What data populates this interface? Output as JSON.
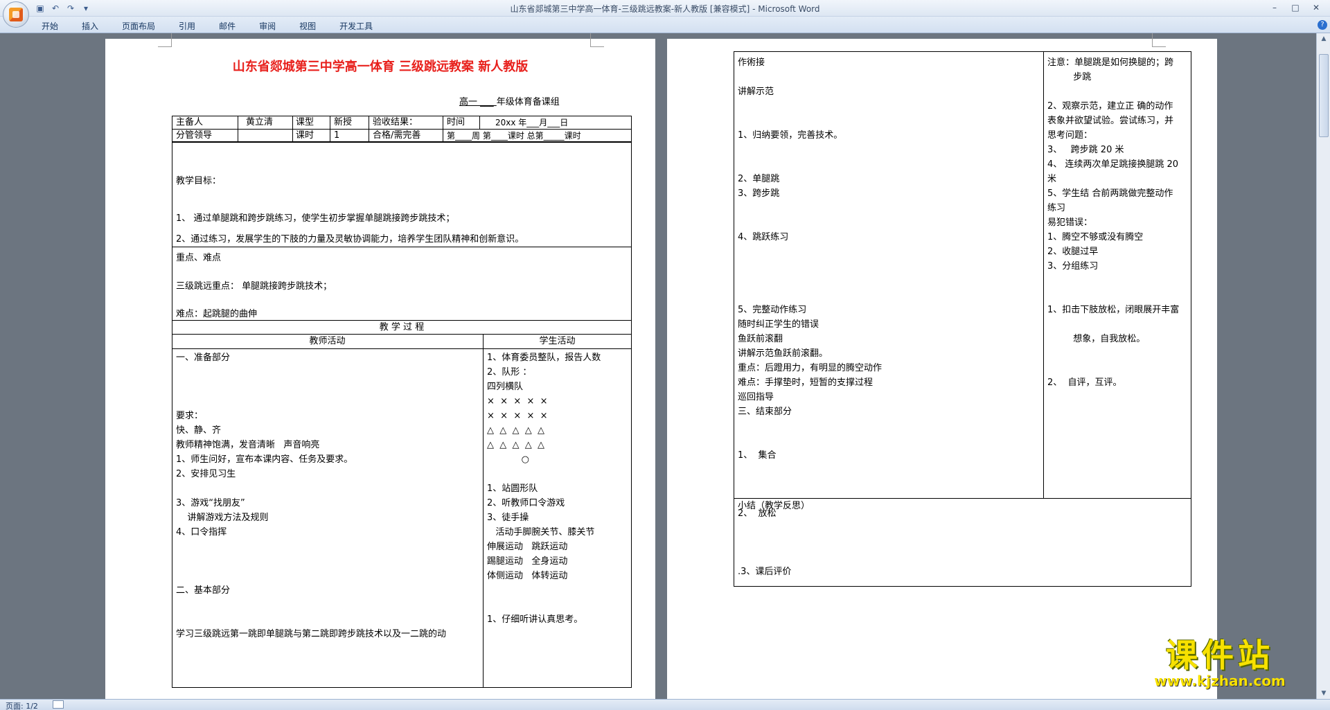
{
  "window": {
    "title": "山东省郯城第三中学高一体育-三级跳远教案-新人教版 [兼容模式] - Microsoft Word",
    "controls": [
      "–",
      "□",
      "✕"
    ]
  },
  "ribbon": {
    "tabs": [
      "开始",
      "插入",
      "页面布局",
      "引用",
      "邮件",
      "审阅",
      "视图",
      "开发工具"
    ],
    "help": "?"
  },
  "status": {
    "page": "页面: 1/2"
  },
  "doc": {
    "title": "山东省郯城第三中学高一体育  三级跳远教案  新人教版",
    "grade_prefix": "高一",
    "grade_suffix": "年级体育备课组",
    "header": {
      "r1": [
        "主备人",
        "黄立清",
        "课型",
        "新授",
        "验收结果：",
        "时间",
        "20xx 年___月___日"
      ],
      "r2": [
        "分管领导",
        "",
        "课时",
        "1",
        "合格/需完善",
        "第____周   第____课时  总第_____课时"
      ]
    },
    "goals_label": "教学目标：",
    "goal1": "1、 通过单腿跳和跨步跳练习，使学生初步掌握单腿跳接跨步跳技术；",
    "goal2": "2、通过练习，发展学生的下肢的力量及灵敏协调能力，培养学生团队精神和创新意识。",
    "key_label": "重点、难点",
    "key_point": "三级跳远重点： 单腿跳接跨步跳技术；",
    "difficulty": "难点：起跳腿的曲伸",
    "process": "教        学        过        程",
    "teacher_col": "教师活动",
    "student_col": "学生活动",
    "teacher_lines": "一、准备部分\n\n\n\n要求：\n快、静、齐\n教师精神饱满，发音清晰   声音响亮\n1、师生问好，宣布本课内容、任务及要求。\n2、安排见习生\n\n3、游戏“找朋友”\n    讲解游戏方法及规则\n4、口令指挥\n\n\n\n二、基本部分\n\n\n学习三级跳远第一跳即单腿跳与第二跳即跨步跳技术以及一二跳的动",
    "student_lines": "1、体育委员整队，报告人数\n2、队形 ：\n四列横队\n×  ×  ×  ×  ×\n×  ×  ×  ×  ×\n△  △  △  △  △\n△  △  △  △  △\n            ○\n\n1、站圆形队\n2、听教师口令游戏\n3、徒手操\n   活动手脚腕关节、膝关节\n伸展运动   跳跃运动\n踢腿运动   全身运动\n体侧运动   体转运动\n\n\n1、仔细听讲认真思考。",
    "p2_left": "作術接\n\n讲解示范\n\n\n1、归纳要领，完善技术。\n\n\n2、单腿跳\n3、跨步跳\n\n\n4、跳跃练习\n\n\n\n\n5、完整动作练习\n随时纠正学生的错误\n鱼跃前滚翻\n讲解示范鱼跃前滚翻。\n重点：后蹬用力，有明显的腾空动作\n难点：手撑垫时，短暂的支撑过程\n巡回指导\n三、结束部分\n\n\n1、  集合\n\n\n\n2、  放松\n\n\n\n.3、课后评价",
    "p2_right": "注意：单腿跳是如何换腿的；跨\n         步跳\n\n2、观察示范，建立正 确的动作\n表象并欲望试验。尝试练习，并\n思考问题：\n3、   跨步跳 20 米\n4、 连续两次单足跳接换腿跳 20\n米\n5、学生结 合前两跳做完整动作\n练习\n易犯错误：\n1、腾空不够或没有腾空\n2、收腿过早\n3、分组练习\n\n\n1、扣击下肢放松，闭眼展开丰富\n\n         想象，自我放松。\n\n\n2、  自评，互评。",
    "summary_label": "小结（教学反思）"
  },
  "watermark": {
    "text": "课件站",
    "url": "www.kjzhan.com"
  }
}
